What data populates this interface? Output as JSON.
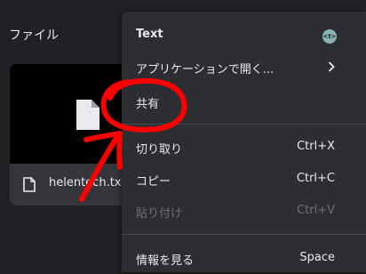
{
  "section": {
    "title": "ファイル"
  },
  "file": {
    "name": "helentech.txt",
    "icon": "document-icon"
  },
  "menu": {
    "header": {
      "label": "Text",
      "badge": "<t>"
    },
    "items": [
      {
        "label": "アプリケーションで開く...",
        "shortcut": ""
      },
      {
        "label": "共有",
        "shortcut": ""
      },
      {
        "label": "切り取り",
        "shortcut": "Ctrl+X"
      },
      {
        "label": "コピー",
        "shortcut": "Ctrl+C"
      },
      {
        "label": "貼り付け",
        "shortcut": "Ctrl+V",
        "disabled": true
      },
      {
        "label": "情報を見る",
        "shortcut": "Space"
      }
    ]
  },
  "annotation": {
    "color": "#ff0000"
  }
}
